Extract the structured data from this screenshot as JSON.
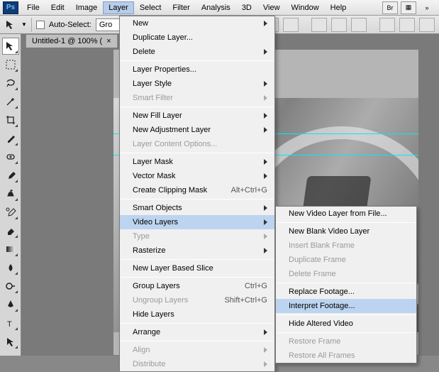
{
  "menubar": {
    "items": [
      "File",
      "Edit",
      "Image",
      "Layer",
      "Select",
      "Filter",
      "Analysis",
      "3D",
      "View",
      "Window",
      "Help"
    ],
    "open_index": 3,
    "right": [
      "Br",
      "▦",
      "»"
    ]
  },
  "optionsbar": {
    "auto_select_label": "Auto-Select:",
    "group_value": "Gro"
  },
  "tab": {
    "title": "Untitled-1 @ 100% (",
    "close": "×"
  },
  "layer_menu": {
    "groups": [
      [
        {
          "label": "New",
          "sub": true
        },
        {
          "label": "Duplicate Layer..."
        },
        {
          "label": "Delete",
          "sub": true
        }
      ],
      [
        {
          "label": "Layer Properties..."
        },
        {
          "label": "Layer Style",
          "sub": true
        },
        {
          "label": "Smart Filter",
          "sub": true,
          "disabled": true
        }
      ],
      [
        {
          "label": "New Fill Layer",
          "sub": true
        },
        {
          "label": "New Adjustment Layer",
          "sub": true
        },
        {
          "label": "Layer Content Options...",
          "disabled": true
        }
      ],
      [
        {
          "label": "Layer Mask",
          "sub": true
        },
        {
          "label": "Vector Mask",
          "sub": true
        },
        {
          "label": "Create Clipping Mask",
          "kbd": "Alt+Ctrl+G"
        }
      ],
      [
        {
          "label": "Smart Objects",
          "sub": true
        },
        {
          "label": "Video Layers",
          "sub": true,
          "hl": true
        },
        {
          "label": "Type",
          "sub": true,
          "disabled": true
        },
        {
          "label": "Rasterize",
          "sub": true
        }
      ],
      [
        {
          "label": "New Layer Based Slice"
        }
      ],
      [
        {
          "label": "Group Layers",
          "kbd": "Ctrl+G"
        },
        {
          "label": "Ungroup Layers",
          "kbd": "Shift+Ctrl+G",
          "disabled": true
        },
        {
          "label": "Hide Layers"
        }
      ],
      [
        {
          "label": "Arrange",
          "sub": true
        }
      ],
      [
        {
          "label": "Align",
          "sub": true,
          "disabled": true
        },
        {
          "label": "Distribute",
          "sub": true,
          "disabled": true
        }
      ]
    ]
  },
  "video_submenu": {
    "groups": [
      [
        {
          "label": "New Video Layer from File..."
        }
      ],
      [
        {
          "label": "New Blank Video Layer"
        },
        {
          "label": "Insert Blank Frame",
          "disabled": true
        },
        {
          "label": "Duplicate Frame",
          "disabled": true
        },
        {
          "label": "Delete Frame",
          "disabled": true
        }
      ],
      [
        {
          "label": "Replace Footage..."
        },
        {
          "label": "Interpret Footage...",
          "hl": true
        }
      ],
      [
        {
          "label": "Hide Altered Video"
        }
      ],
      [
        {
          "label": "Restore Frame",
          "disabled": true
        },
        {
          "label": "Restore All Frames",
          "disabled": true
        }
      ]
    ]
  }
}
